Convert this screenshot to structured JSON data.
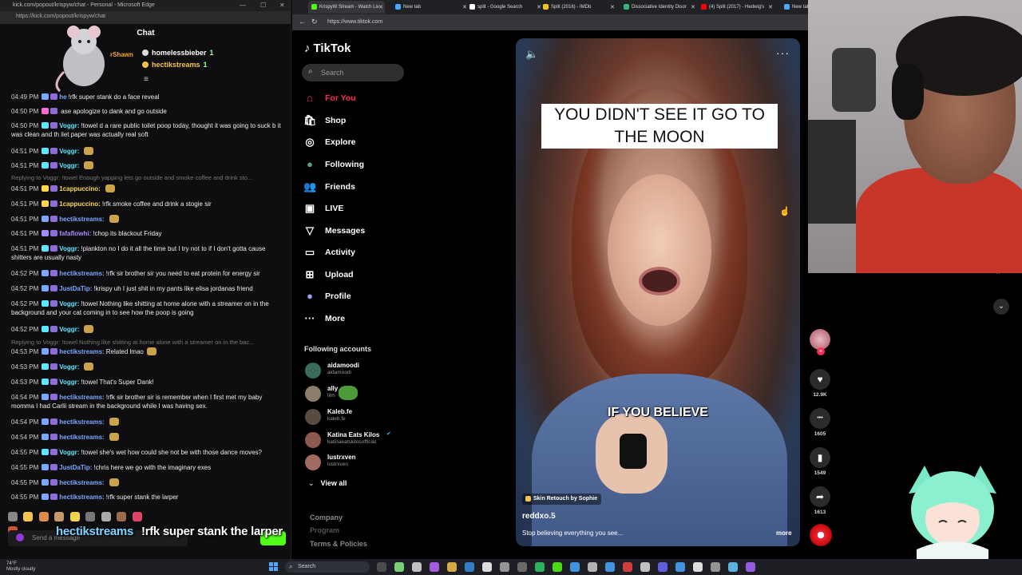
{
  "chat_window": {
    "title": "kick.com/popout/krispyw/chat - Personal - Microsoft Edge",
    "url": "https://kick.com/popout/krispyw/chat",
    "header": "Chat",
    "gifters": [
      {
        "name": "homelessbieber",
        "count": "1"
      },
      {
        "name": "hectikstreams",
        "count": "1"
      }
    ],
    "pinned_partial_name": "rShawn",
    "messages": [
      {
        "time": "04:49 PM",
        "user": "he",
        "color": "#7aa7ff",
        "text": "!rfk super stank do a face reveal",
        "emote": false
      },
      {
        "time": "04:50 PM",
        "user": "",
        "color": "#ff6bd5",
        "text": "ase apologize to dank and go outside",
        "emote": false
      },
      {
        "time": "04:50 PM",
        "user": "Voggr:",
        "color": "#5ee7ff",
        "text": "!towel d a rare public toilet poop today, thought it was going to suck b it was clean and th ilet paper was actually real soft",
        "emote": false
      },
      {
        "time": "04:51 PM",
        "user": "Voggr:",
        "color": "#5ee7ff",
        "text": "",
        "emote": true
      },
      {
        "time": "04:51 PM",
        "user": "Voggr:",
        "color": "#5ee7ff",
        "text": "",
        "emote": true
      },
      {
        "time": "04:51 PM",
        "user": "1cappuccino:",
        "color": "#ffd84a",
        "text": "",
        "emote": true
      },
      {
        "time": "04:51 PM",
        "user": "1cappuccino:",
        "color": "#ffd84a",
        "text": "!rfk smoke coffee and drink a stogie sir",
        "emote": false
      },
      {
        "time": "04:51 PM",
        "user": "hectikstreams:",
        "color": "#7aa7ff",
        "text": "",
        "emote": true
      },
      {
        "time": "04:51 PM",
        "user": "fafaflowhi:",
        "color": "#a58bff",
        "text": "!chop its blackout Friday",
        "emote": false
      },
      {
        "time": "04:51 PM",
        "user": "Voggr:",
        "color": "#5ee7ff",
        "text": "!plankton no I do it all the time but I try not to if I don't gotta cause shitters are usually nasty",
        "emote": false
      },
      {
        "time": "04:52 PM",
        "user": "hectikstreams:",
        "color": "#7aa7ff",
        "text": "!rfk sir brother sir you need to eat protein for energy sir",
        "emote": false
      },
      {
        "time": "04:52 PM",
        "user": "JustDaTip:",
        "color": "#7aa7ff",
        "text": "!krispy uh I just shit in my pants like elisa jordanas friend",
        "emote": false
      },
      {
        "time": "04:52 PM",
        "user": "Voggr:",
        "color": "#5ee7ff",
        "text": "!towel Nothing like shitting at home alone with a streamer on in the background and your cat coming in to see how the poop is going",
        "emote": false
      },
      {
        "time": "04:52 PM",
        "user": "Voggr:",
        "color": "#5ee7ff",
        "text": "",
        "emote": true
      },
      {
        "time": "04:53 PM",
        "user": "hectikstreams:",
        "color": "#7aa7ff",
        "text": "Related lmao",
        "emote": true
      },
      {
        "time": "04:53 PM",
        "user": "Voggr:",
        "color": "#5ee7ff",
        "text": "",
        "emote": true
      },
      {
        "time": "04:53 PM",
        "user": "Voggr:",
        "color": "#5ee7ff",
        "text": "!towel That's Super Dank!",
        "emote": false
      },
      {
        "time": "04:54 PM",
        "user": "hectikstreams:",
        "color": "#7aa7ff",
        "text": "!rfk sir brother sir is remember when I first met my baby momma I had Carlii stream in the background while I was having sex.",
        "emote": false
      },
      {
        "time": "04:54 PM",
        "user": "hectikstreams:",
        "color": "#7aa7ff",
        "text": "",
        "emote": true
      },
      {
        "time": "04:54 PM",
        "user": "hectikstreams:",
        "color": "#7aa7ff",
        "text": "",
        "emote": true
      },
      {
        "time": "04:55 PM",
        "user": "Voggr:",
        "color": "#5ee7ff",
        "text": "!towel she's wet how could she not be with those dance moves?",
        "emote": false
      },
      {
        "time": "04:55 PM",
        "user": "JustDaTip:",
        "color": "#7aa7ff",
        "text": "!chris here we go with the imaginary exes",
        "emote": false
      },
      {
        "time": "04:55 PM",
        "user": "hectikstreams:",
        "color": "#7aa7ff",
        "text": "",
        "emote": true
      },
      {
        "time": "04:55 PM",
        "user": "hectikstreams:",
        "color": "#7aa7ff",
        "text": "!rfk super stank the larper",
        "emote": false
      }
    ],
    "replies": [
      "Replying to Voggr: !towel Enough yapping lets go outside and smoke coffee and drink sto...",
      "Replying to Voggr: !towel Nothing like shitting at home alone with a streamer on in the bac..."
    ],
    "send_placeholder": "Send a message",
    "overlay_caption": {
      "user": "hectikstreams",
      "text": "!rfk super stank the larper"
    }
  },
  "browser": {
    "tabs": [
      {
        "label": "KrispyW Stream - Watch Liv",
        "color": "#53fc18"
      },
      {
        "label": "New tab",
        "color": "#4aa8ff"
      },
      {
        "label": "split - Google Search",
        "color": "#ffffff"
      },
      {
        "label": "Split (2016) - IMDb",
        "color": "#f5c518"
      },
      {
        "label": "Dissociative Identity Disor",
        "color": "#3ab37a"
      },
      {
        "label": "(4) Split (2017) - Hedwig's",
        "color": "#ff0000"
      },
      {
        "label": "New tab",
        "color": "#4aa8ff"
      }
    ],
    "url": "https://www.tiktok.com"
  },
  "tiktok": {
    "logo": "TikTok",
    "search_placeholder": "Search",
    "nav": [
      {
        "label": "For You",
        "icon": "home-icon",
        "glyph": "⌂",
        "active": true
      },
      {
        "label": "Shop",
        "icon": "shop-icon",
        "glyph": "🛍",
        "active": false
      },
      {
        "label": "Explore",
        "icon": "compass-icon",
        "glyph": "◎",
        "active": false
      },
      {
        "label": "Following",
        "icon": "following-avatar-icon",
        "glyph": "●",
        "active": false
      },
      {
        "label": "Friends",
        "icon": "friends-icon",
        "glyph": "👥",
        "active": false
      },
      {
        "label": "LIVE",
        "icon": "live-icon",
        "glyph": "▣",
        "active": false
      },
      {
        "label": "Messages",
        "icon": "messages-icon",
        "glyph": "▽",
        "active": false
      },
      {
        "label": "Activity",
        "icon": "activity-icon",
        "glyph": "▭",
        "active": false
      },
      {
        "label": "Upload",
        "icon": "upload-icon",
        "glyph": "⊞",
        "active": false
      },
      {
        "label": "Profile",
        "icon": "profile-icon",
        "glyph": "●",
        "active": false
      },
      {
        "label": "More",
        "icon": "more-dots-icon",
        "glyph": "···",
        "active": false
      }
    ],
    "following_title": "Following accounts",
    "following": [
      {
        "name": "aidamoodi",
        "handle": "aidamoodi",
        "color": "#3a6b5a"
      },
      {
        "name": "ally",
        "handle": "lilm",
        "color": "#8a7d6a"
      },
      {
        "name": "Kaleb.fe",
        "handle": "kaleb.fe",
        "color": "#5a4a40"
      },
      {
        "name": "Katina Eats Kilos",
        "handle": "katinaeatskilosofficial",
        "color": "#8c5a4e"
      },
      {
        "name": "lustrxven",
        "handle": "lustrxven",
        "color": "#a06a60"
      }
    ],
    "view_all": "View all",
    "footer": [
      "Company",
      "Program",
      "Terms & Policies"
    ],
    "video": {
      "caption_top": "YOU DIDN'T SEE IT GO TO THE MOON",
      "caption_mid": "IF YOU BELIEVE",
      "effect": "Skin Retouch by Sophie",
      "author": "reddxo.5",
      "description": "Stop believing everything you see... ",
      "more": "more"
    },
    "actions": [
      {
        "icon": "heart-icon",
        "glyph": "♥",
        "count": "12.9K"
      },
      {
        "icon": "comment-icon",
        "glyph": "•••",
        "count": "1605"
      },
      {
        "icon": "bookmark-icon",
        "glyph": "▮",
        "count": "1549"
      },
      {
        "icon": "share-icon",
        "glyph": "➦",
        "count": "1613"
      }
    ]
  },
  "taskbar": {
    "weather_temp": "74°F",
    "weather_desc": "Mostly cloudy",
    "search_label": "Search"
  }
}
